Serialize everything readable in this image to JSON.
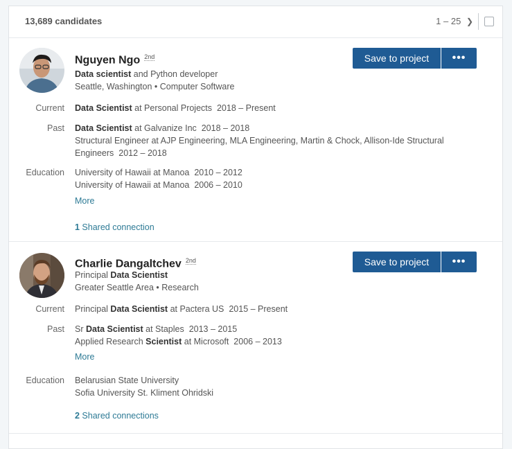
{
  "header": {
    "count": "13,689 candidates",
    "pager": "1 – 25",
    "pager_next": "❯"
  },
  "actions": {
    "save_label": "Save to project",
    "more_label": "•••"
  },
  "candidates": [
    {
      "name": "Nguyen Ngo",
      "degree": "2nd",
      "headline_bold": "Data scientist",
      "headline_rest": " and Python developer",
      "location": "Seattle, Washington",
      "industry": "Computer Software",
      "current_label": "Current",
      "current": {
        "title": "Data Scientist",
        "rest": " at Personal Projects",
        "dates": "2018 – Present"
      },
      "past_label": "Past",
      "past": [
        {
          "title": "Data Scientist",
          "rest": " at Galvanize Inc",
          "dates": "2018 – 2018"
        },
        {
          "text": "Structural Engineer at AJP Engineering, MLA Engineering, Martin & Chock, Allison-Ide Structural"
        },
        {
          "text": "Engineers",
          "dates": "2012 – 2018"
        }
      ],
      "education_label": "Education",
      "education": [
        {
          "school": "University of Hawaii at Manoa",
          "dates": "2010 – 2012"
        },
        {
          "school": "University of Hawaii at Manoa",
          "dates": "2006 – 2010"
        }
      ],
      "more_label": "More",
      "shared_num": "1",
      "shared_text": " Shared connection"
    },
    {
      "name": "Charlie Dangaltchev",
      "degree": "2nd",
      "headline_pre": "Principal ",
      "headline_bold": "Data Scientist",
      "location": "Greater Seattle Area",
      "industry": "Research",
      "current_label": "Current",
      "current": {
        "pre": "Principal ",
        "title": "Data Scientist",
        "rest": " at Pactera US",
        "dates": "2015 – Present"
      },
      "past_label": "Past",
      "past": [
        {
          "pre": "Sr ",
          "title": "Data Scientist",
          "rest": " at Staples",
          "dates": "2013 – 2015"
        },
        {
          "pre": "Applied Research ",
          "title": "Scientist",
          "rest": " at Microsoft",
          "dates": "2006 – 2013"
        }
      ],
      "more_label": "More",
      "education_label": "Education",
      "education": [
        {
          "school": "Belarusian State University"
        },
        {
          "school": "Sofia University St. Kliment Ohridski"
        }
      ],
      "shared_num": "2",
      "shared_text": " Shared connections"
    }
  ]
}
